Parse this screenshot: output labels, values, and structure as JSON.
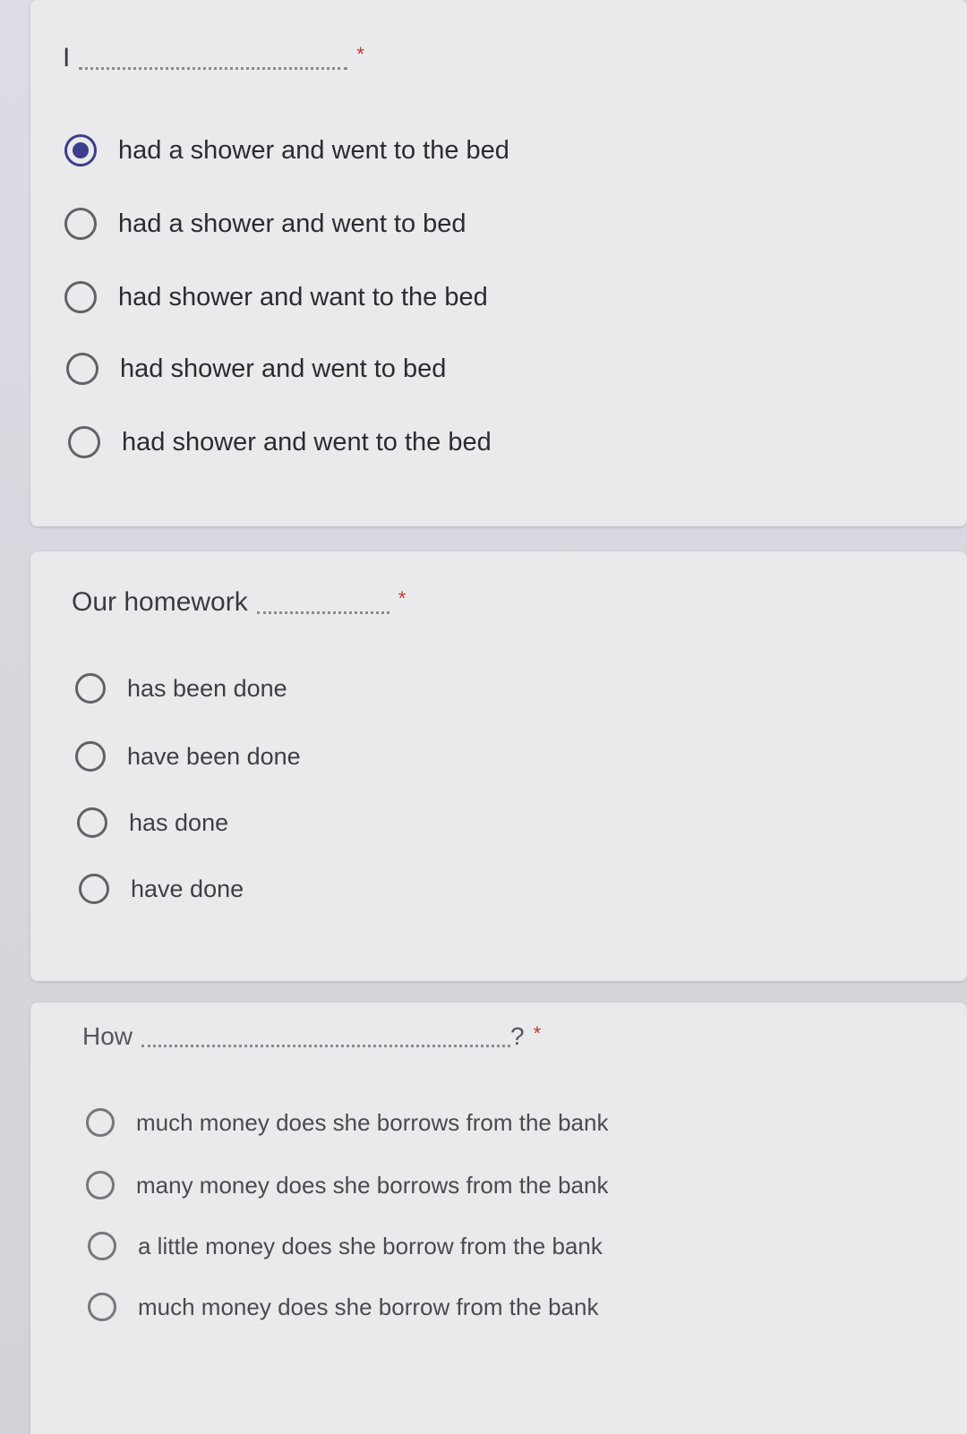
{
  "questions": [
    {
      "prompt": "I",
      "suffix": "",
      "required_mark": "*",
      "options": [
        {
          "label": "had a shower and went to the bed",
          "selected": true
        },
        {
          "label": "had a shower and went to bed",
          "selected": false
        },
        {
          "label": "had shower and want to the bed",
          "selected": false
        },
        {
          "label": "had shower and went to bed",
          "selected": false
        },
        {
          "label": "had shower and went to the bed",
          "selected": false
        }
      ]
    },
    {
      "prompt": "Our homework",
      "suffix": "",
      "required_mark": "*",
      "options": [
        {
          "label": "has been done",
          "selected": false
        },
        {
          "label": "have been done",
          "selected": false
        },
        {
          "label": "has done",
          "selected": false
        },
        {
          "label": "have done",
          "selected": false
        }
      ]
    },
    {
      "prompt": "How",
      "suffix": "?",
      "required_mark": "*",
      "options": [
        {
          "label": "much money does she borrows from the bank",
          "selected": false
        },
        {
          "label": "many money does she borrows from the bank",
          "selected": false
        },
        {
          "label": "a little money does she borrow from the bank",
          "selected": false
        },
        {
          "label": "much money does she borrow from the bank",
          "selected": false
        }
      ]
    }
  ],
  "colors": {
    "accent": "#3c3f8c",
    "required": "#c0392b"
  }
}
